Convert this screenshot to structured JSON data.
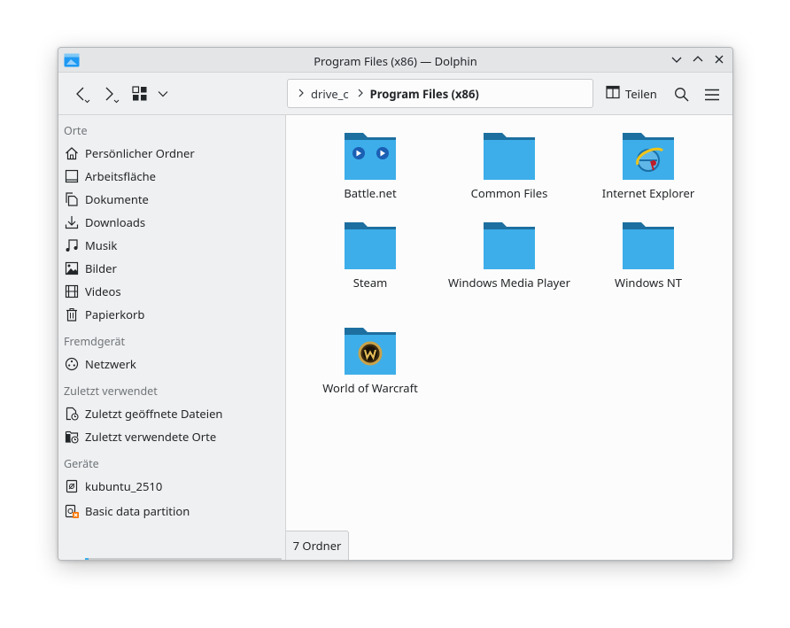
{
  "window": {
    "title": "Program Files (x86) — Dolphin"
  },
  "toolbar": {
    "back_icon": "chevron-left-icon",
    "forward_icon": "chevron-right-icon",
    "view_mode_icon": "icon-view-icon",
    "teilen_label": "Teilen",
    "search_icon": "search-icon",
    "menu_icon": "hamburger-menu-icon"
  },
  "breadcrumb": {
    "items": [
      "drive_c",
      "Program Files (x86)"
    ]
  },
  "sidebar": {
    "sections": {
      "orte": "Orte",
      "fremdgeraet": "Fremdgerät",
      "zuletzt": "Zuletzt verwendet",
      "geraete": "Geräte"
    },
    "places": [
      {
        "label": "Persönlicher Ordner",
        "icon": "home-icon"
      },
      {
        "label": "Arbeitsfläche",
        "icon": "desktop-icon"
      },
      {
        "label": "Dokumente",
        "icon": "documents-icon"
      },
      {
        "label": "Downloads",
        "icon": "download-icon"
      },
      {
        "label": "Musik",
        "icon": "music-icon"
      },
      {
        "label": "Bilder",
        "icon": "pictures-icon"
      },
      {
        "label": "Videos",
        "icon": "videos-icon"
      },
      {
        "label": "Papierkorb",
        "icon": "trash-icon"
      }
    ],
    "remote": [
      {
        "label": "Netzwerk",
        "icon": "network-icon"
      }
    ],
    "recent": [
      {
        "label": "Zuletzt geöffnete Dateien",
        "icon": "recent-files-icon"
      },
      {
        "label": "Zuletzt verwendete Orte",
        "icon": "recent-places-icon"
      }
    ],
    "devices": [
      {
        "label": "kubuntu_2510",
        "icon": "drive-icon"
      },
      {
        "label": "Basic data partition",
        "icon": "drive-warning-icon"
      }
    ]
  },
  "files": [
    {
      "name": "Battle.net",
      "icon": "folder-battlenet-icon"
    },
    {
      "name": "Common Files",
      "icon": "folder-icon"
    },
    {
      "name": "Internet Explorer",
      "icon": "folder-ie-icon"
    },
    {
      "name": "Steam",
      "icon": "folder-icon"
    },
    {
      "name": "Windows Media Player",
      "icon": "folder-icon"
    },
    {
      "name": "Windows NT",
      "icon": "folder-icon"
    },
    {
      "name": "World of Warcraft",
      "icon": "folder-wow-icon"
    }
  ],
  "status": {
    "text": "7 Ordner"
  },
  "colors": {
    "folder_body": "#3daee9",
    "folder_tab": "#1d6fa0",
    "accent": "#3daee9"
  }
}
